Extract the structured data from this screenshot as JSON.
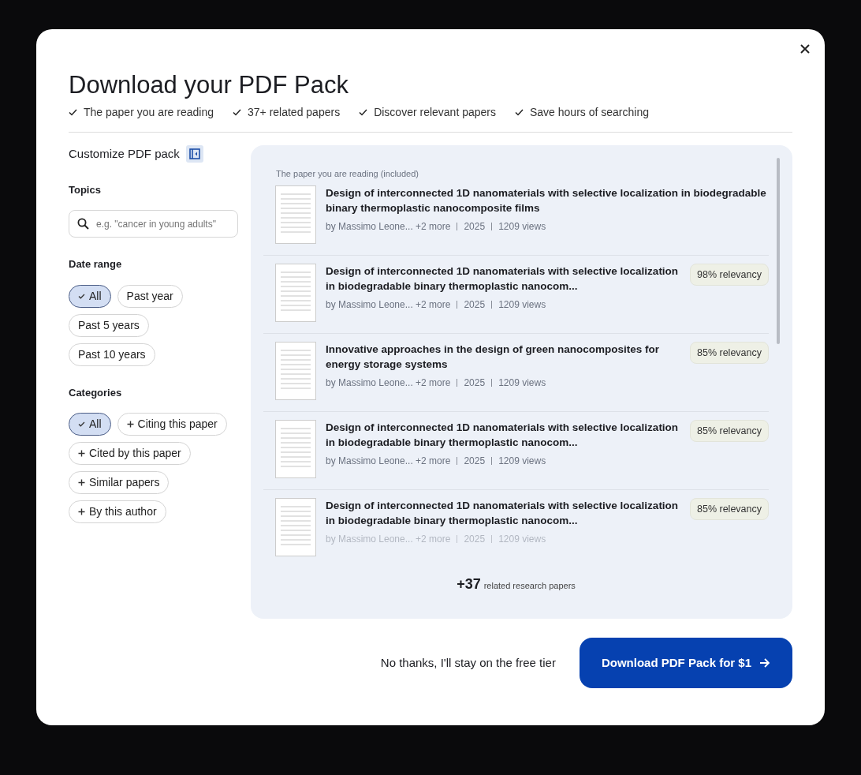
{
  "modal": {
    "title": "Download your PDF Pack",
    "benefits": [
      "The paper you are reading",
      "37+ related papers",
      "Discover relevant papers",
      "Save hours of searching"
    ]
  },
  "sidebar": {
    "heading": "Customize PDF pack",
    "topics": {
      "label": "Topics",
      "placeholder": "e.g. \"cancer in young adults\""
    },
    "date_range": {
      "label": "Date range",
      "options": [
        {
          "label": "All",
          "selected": true
        },
        {
          "label": "Past year",
          "selected": false
        },
        {
          "label": "Past 5 years",
          "selected": false
        },
        {
          "label": "Past 10 years",
          "selected": false
        }
      ]
    },
    "categories": {
      "label": "Categories",
      "options": [
        {
          "label": "All",
          "selected": true
        },
        {
          "label": "Citing this paper",
          "selected": false
        },
        {
          "label": "Cited by this paper",
          "selected": false
        },
        {
          "label": "Similar papers",
          "selected": false
        },
        {
          "label": "By this author",
          "selected": false
        }
      ]
    }
  },
  "papers": {
    "included_label": "The paper you are reading (included)",
    "items": [
      {
        "title": "Design of interconnected 1D nanomaterials with selective localization in biodegradable binary thermoplastic nanocomposite films",
        "authors": "by Massimo Leone... +2 more",
        "year": "2025",
        "views": "1209 views",
        "faded": false
      },
      {
        "title": "Design of interconnected 1D nanomaterials with selective localization in biodegradable binary thermoplastic nanocom...",
        "authors": "by Massimo Leone... +2 more",
        "year": "2025",
        "views": "1209 views",
        "relevancy": "98% relevancy",
        "faded": false
      },
      {
        "title": "Innovative approaches in the design of green nanocomposites for energy storage systems",
        "authors": "by Massimo Leone... +2 more",
        "year": "2025",
        "views": "1209 views",
        "relevancy": "85% relevancy",
        "faded": false
      },
      {
        "title": "Design of interconnected 1D nanomaterials with selective localization in biodegradable binary thermoplastic nanocom...",
        "authors": "by Massimo Leone... +2 more",
        "year": "2025",
        "views": "1209 views",
        "relevancy": "85% relevancy",
        "faded": false
      },
      {
        "title": "Design of interconnected 1D nanomaterials with selective localization in biodegradable binary thermoplastic nanocom...",
        "authors": "by Massimo Leone... +2 more",
        "year": "2025",
        "views": "1209 views",
        "relevancy": "85% relevancy",
        "faded": true
      }
    ],
    "more_count": "+37",
    "more_label": "related research papers"
  },
  "footer": {
    "decline": "No thanks, I'll stay on the free tier",
    "download": "Download PDF Pack for $1"
  }
}
